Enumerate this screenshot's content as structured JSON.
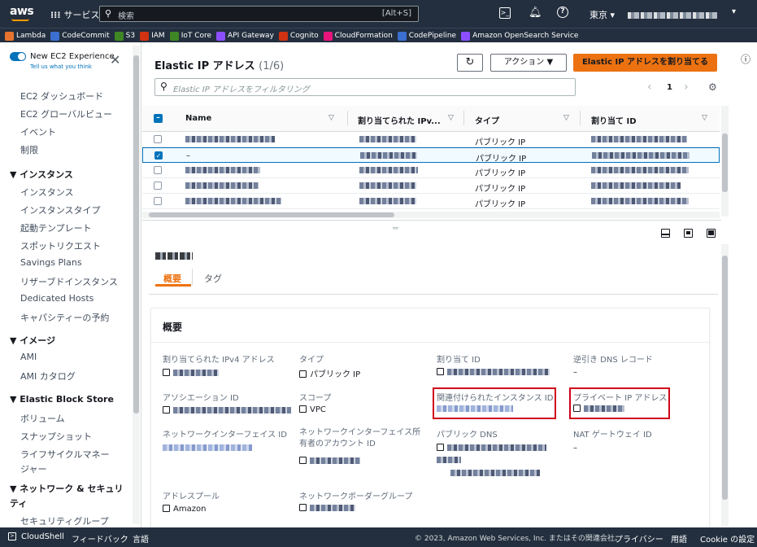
{
  "topbar": {
    "logo": "aws",
    "services": "サービス",
    "search_placeholder": "検索",
    "search_shortcut": "[Alt+S]",
    "region": "東京 ▾"
  },
  "favorites": [
    {
      "label": "Lambda",
      "color": "#e7742e"
    },
    {
      "label": "CodeCommit",
      "color": "#3b6fd1"
    },
    {
      "label": "S3",
      "color": "#3f8624"
    },
    {
      "label": "IAM",
      "color": "#d13212"
    },
    {
      "label": "IoT Core",
      "color": "#3f8624"
    },
    {
      "label": "API Gateway",
      "color": "#8c4fff"
    },
    {
      "label": "Cognito",
      "color": "#d13212"
    },
    {
      "label": "CloudFormation",
      "color": "#e7157b"
    },
    {
      "label": "CodePipeline",
      "color": "#3b6fd1"
    },
    {
      "label": "Amazon OpenSearch Service",
      "color": "#8c4fff"
    }
  ],
  "sidebar": {
    "toggle_label": "New EC2 Experience",
    "toggle_sub": "Tell us what you think",
    "items": [
      {
        "label": "EC2 ダッシュボード",
        "type": "item"
      },
      {
        "label": "EC2 グローバルビュー",
        "type": "item"
      },
      {
        "label": "イベント",
        "type": "item"
      },
      {
        "label": "制限",
        "type": "item"
      },
      {
        "label": "▼ インスタンス",
        "type": "head"
      },
      {
        "label": "インスタンス",
        "type": "item"
      },
      {
        "label": "インスタンスタイプ",
        "type": "item"
      },
      {
        "label": "起動テンプレート",
        "type": "item"
      },
      {
        "label": "スポットリクエスト",
        "type": "item"
      },
      {
        "label": "Savings Plans",
        "type": "item"
      },
      {
        "label": "リザーブドインスタンス",
        "type": "item"
      },
      {
        "label": "Dedicated Hosts",
        "type": "item"
      },
      {
        "label": "キャパシティーの予約",
        "type": "item"
      },
      {
        "label": "▼ イメージ",
        "type": "head"
      },
      {
        "label": "AMI",
        "type": "item"
      },
      {
        "label": "AMI カタログ",
        "type": "item"
      },
      {
        "label": "▼ Elastic Block Store",
        "type": "head"
      },
      {
        "label": "ボリューム",
        "type": "item"
      },
      {
        "label": "スナップショット",
        "type": "item"
      },
      {
        "label": "ライフサイクルマネージャー",
        "type": "item"
      },
      {
        "label": "▼ ネットワーク & セキュリティ",
        "type": "head"
      },
      {
        "label": "セキュリティグループ",
        "type": "item"
      }
    ]
  },
  "page": {
    "title": "Elastic IP アドレス",
    "count": "(1/6)",
    "actions_label": "アクション ▼",
    "allocate_label": "Elastic IP アドレスを割り当てる",
    "filter_placeholder": "Elastic IP アドレスをフィルタリング",
    "page_number": "1"
  },
  "table": {
    "columns": [
      "Name",
      "割り当てられた IPv...",
      "タイプ",
      "割り当て ID"
    ],
    "rows": [
      {
        "name": "",
        "ip": "",
        "type": "パブリック IP",
        "selected": false
      },
      {
        "name": "–",
        "ip": "",
        "type": "パブリック IP",
        "selected": true
      },
      {
        "name": "",
        "ip": "",
        "type": "パブリック IP",
        "selected": false
      },
      {
        "name": "",
        "ip": "",
        "type": "パブリック IP",
        "selected": false
      },
      {
        "name": "",
        "ip": "",
        "type": "パブリック IP",
        "selected": false
      }
    ]
  },
  "detail": {
    "tabs": [
      "概要",
      "タグ"
    ],
    "section_title": "概要",
    "fields": {
      "allocated_ipv4": "割り当てられた IPv4 アドレス",
      "type": "タイプ",
      "type_value": "パブリック IP",
      "allocation_id": "割り当て ID",
      "reverse_dns": "逆引き DNS レコード",
      "reverse_dns_value": "–",
      "association_id": "アソシエーション ID",
      "scope": "スコープ",
      "scope_value": "VPC",
      "associated_instance": "関連付けられたインスタンス ID",
      "private_ip": "プライベート IP アドレス",
      "eni_id": "ネットワークインターフェイス ID",
      "eni_owner": "ネットワークインターフェイス所有者のアカウント ID",
      "public_dns": "パブリック DNS",
      "nat_gateway": "NAT ゲートウェイ ID",
      "nat_gateway_value": "–",
      "address_pool": "アドレスプール",
      "address_pool_value": "Amazon",
      "border_group": "ネットワークボーダーグループ"
    }
  },
  "footer": {
    "cloudshell": "CloudShell",
    "feedback": "フィードバック",
    "language": "言語",
    "copyright": "© 2023, Amazon Web Services, Inc. またはその関連会社。",
    "privacy": "プライバシー",
    "terms": "用語",
    "cookies": "Cookie の設定"
  },
  "colors": {
    "nav": "#232f3e",
    "accent": "#ec7211",
    "link": "#0073bb",
    "selected_row": "#f1faff",
    "highlight_box": "#d0021b"
  }
}
